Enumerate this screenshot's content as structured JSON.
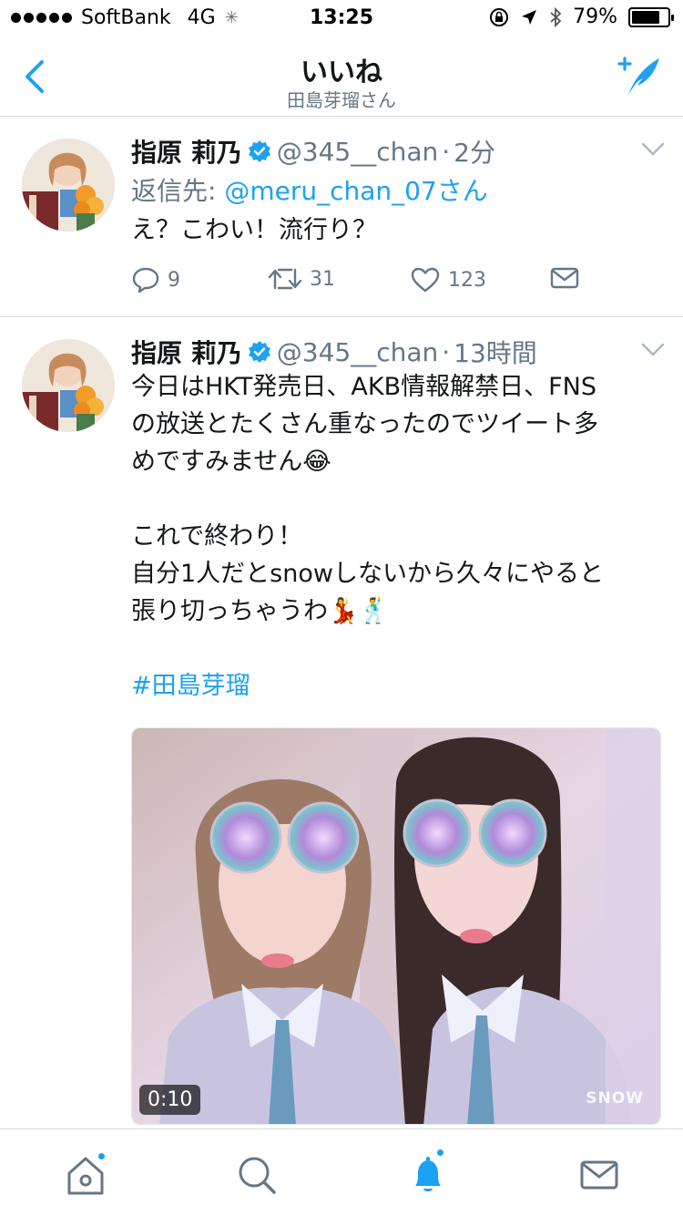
{
  "status_bar": {
    "carrier": "SoftBank",
    "network": "4G",
    "time": "13:25",
    "battery_percent": "79%",
    "battery_level": 0.79
  },
  "nav": {
    "title": "いいね",
    "subtitle": "田島芽瑠さん",
    "back_icon": "chevron-left-icon",
    "compose_icon": "compose-tweet-icon"
  },
  "tweets": [
    {
      "display_name": "指原 莉乃",
      "handle": "@345__chan",
      "separator": "·",
      "time": "2分",
      "reply_to_label": "返信先:",
      "reply_to_mention": "@meru_chan_07さん",
      "lines": [
        "え？こわい！流行り？"
      ],
      "reply_count": "9",
      "retweet_count": "31",
      "like_count": "123"
    },
    {
      "display_name": "指原 莉乃",
      "handle": "@345__chan",
      "separator": "·",
      "time": "13時間",
      "lines": [
        "今日はHKT発売日、AKB情報解禁日、FNS",
        "の放送とたくさん重なったのでツイート多",
        "めですみません😂",
        "",
        "これで終わり！",
        "自分1人だとsnowしないから久々にやると",
        "張り切っちゃうわ💃🕺",
        ""
      ],
      "hashtag": "#田島芽瑠",
      "media": {
        "duration": "0:10",
        "watermark": "SNOW"
      }
    }
  ],
  "tab_bar": {
    "items": [
      {
        "icon": "home-icon",
        "badge": true
      },
      {
        "icon": "search-icon",
        "badge": false
      },
      {
        "icon": "notifications-bell-icon",
        "badge": true,
        "active": true
      },
      {
        "icon": "messages-icon",
        "badge": false
      }
    ]
  },
  "colors": {
    "accent": "#1da1f2",
    "text": "#14171a",
    "secondary": "#657786",
    "divider": "#d8dde2"
  }
}
